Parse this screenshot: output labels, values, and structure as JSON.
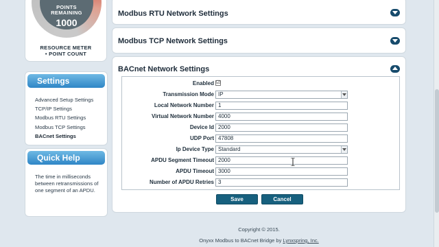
{
  "meter": {
    "label_line1": "POINTS",
    "label_line2": "REMAINING",
    "value": "1000",
    "caption1": "RESOURCE METER",
    "caption2": "• POINT COUNT"
  },
  "settings_panel": {
    "title": "Settings",
    "items": [
      {
        "label": "Advanced Setup Settings",
        "active": false
      },
      {
        "label": "TCP/IP Settings",
        "active": false
      },
      {
        "label": "Modbus RTU Settings",
        "active": false
      },
      {
        "label": "Modbus TCP Settings",
        "active": false
      },
      {
        "label": "BACnet Settings",
        "active": true
      }
    ]
  },
  "help_panel": {
    "title": "Quick Help",
    "text": "The time in milliseconds between retransmissions of one segment of an APDU."
  },
  "sections": {
    "rtu": {
      "title": "Modbus RTU Network Settings",
      "expanded": false
    },
    "tcp": {
      "title": "Modbus TCP Network Settings",
      "expanded": false
    },
    "bacnet": {
      "title": "BACnet Network Settings",
      "expanded": true
    }
  },
  "bacnet_form": {
    "enabled": {
      "label": "Enabled",
      "checked": true,
      "mark": "☑"
    },
    "transmission_mode": {
      "label": "Transmission Mode",
      "value": "IP"
    },
    "local_network_number": {
      "label": "Local Network Number",
      "value": "1"
    },
    "virtual_network_number": {
      "label": "Virtual Network Number",
      "value": "4000"
    },
    "device_id": {
      "label": "Device Id",
      "value": "2000"
    },
    "udp_port": {
      "label": "UDP Port",
      "value": "47808"
    },
    "ip_device_type": {
      "label": "Ip Device Type",
      "value": "Standard"
    },
    "apdu_segment_timeout": {
      "label": "APDU Segment Timeout",
      "value": "2000"
    },
    "apdu_timeout": {
      "label": "APDU Timeout",
      "value": "3000"
    },
    "apdu_retries": {
      "label": "Number of APDU Retries",
      "value": "3"
    }
  },
  "buttons": {
    "save": "Save",
    "cancel": "Cancel"
  },
  "footer": {
    "copyright": "Copyright © 2015.",
    "product_prefix": "Onyxx Modbus to BACnet Bridge by ",
    "company": "Lynxspring, Inc."
  },
  "colors": {
    "header_blue": "#2f86c6",
    "button_teal": "#17607e",
    "toggle_navy": "#174b6c",
    "gauge_red": "#c43b2f"
  }
}
